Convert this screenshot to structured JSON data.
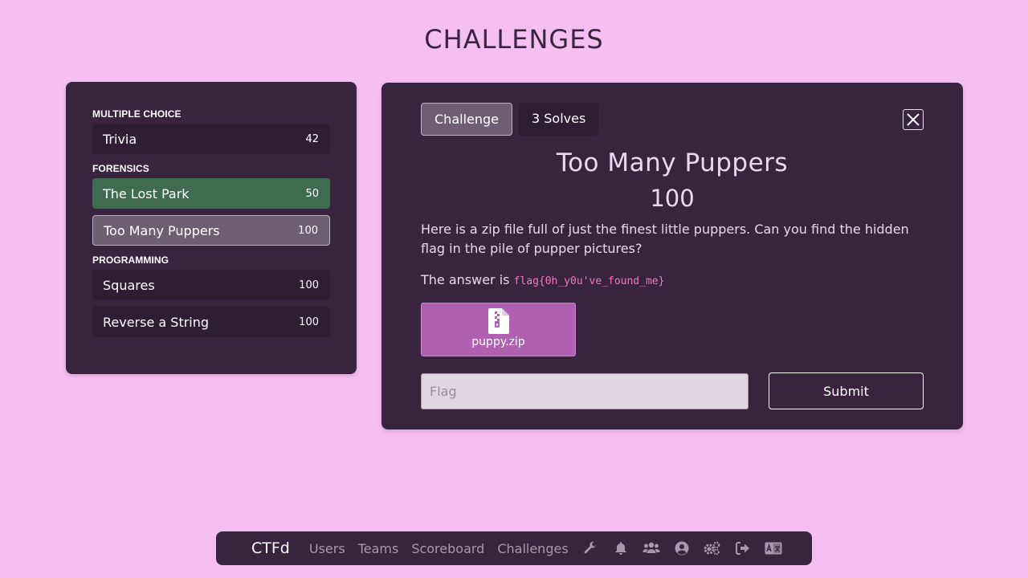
{
  "page": {
    "title": "CHALLENGES"
  },
  "categories": [
    {
      "name": "MULTIPLE CHOICE",
      "challenges": [
        {
          "name": "Trivia",
          "points": "42",
          "state": "default"
        }
      ]
    },
    {
      "name": "FORENSICS",
      "challenges": [
        {
          "name": "The Lost Park",
          "points": "50",
          "state": "solved"
        },
        {
          "name": "Too Many Puppers",
          "points": "100",
          "state": "active"
        }
      ]
    },
    {
      "name": "PROGRAMMING",
      "challenges": [
        {
          "name": "Squares",
          "points": "100",
          "state": "default"
        },
        {
          "name": "Reverse a String",
          "points": "100",
          "state": "default"
        }
      ]
    }
  ],
  "modal": {
    "tabs": [
      {
        "label": "Challenge",
        "active": true
      },
      {
        "label": "3 Solves",
        "active": false
      }
    ],
    "name": "Too Many Puppers",
    "value": "100",
    "description": "Here is a zip file full of just the finest little puppers. Can you find the hidden flag in the pile of pupper pictures?",
    "answer_prefix": "The answer is",
    "answer_code": "flag{0h_y0u've_found_me}",
    "file": {
      "name": "puppy.zip",
      "icon": "file-zip-icon"
    },
    "flag_placeholder": "Flag",
    "flag_value": "",
    "submit_label": "Submit"
  },
  "navbar": {
    "brand": "CTFd",
    "links": [
      "Users",
      "Teams",
      "Scoreboard",
      "Challenges"
    ],
    "icons": [
      "wrench-icon",
      "bell-icon",
      "users-icon",
      "user-circle-icon",
      "cogs-icon",
      "sign-out-icon",
      "language-icon"
    ]
  },
  "colors": {
    "background": "#f5bff2",
    "panel": "#38243e",
    "solved": "#3f6b50",
    "accent_file": "#b060b0",
    "code": "#f078c0"
  }
}
